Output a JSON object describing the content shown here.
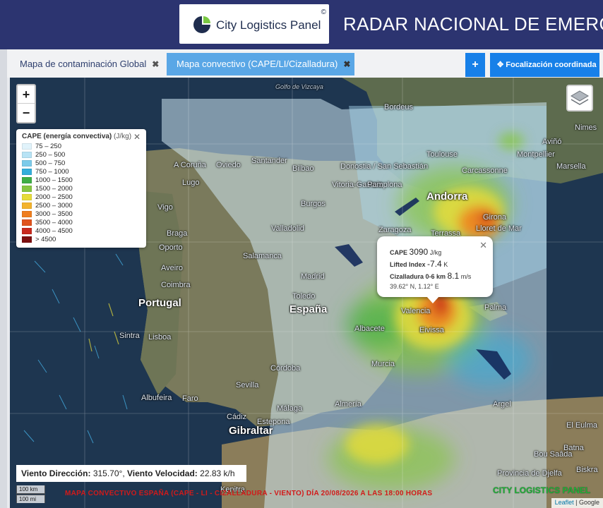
{
  "header": {
    "logo_text": "City Logistics Panel",
    "logo_copyright": "©",
    "title": "RADAR NACIONAL DE EMERGE"
  },
  "tabs": [
    {
      "label": "Mapa de contaminación Global",
      "close": "✖",
      "active": false
    },
    {
      "label": "Mapa convectivo (CAPE/LI/Cizalladura)",
      "close": "✖",
      "active": true
    }
  ],
  "toolbar": {
    "plus_label": "+",
    "focus_icon": "crosshair-icon",
    "focus_label": "Focalización coordinada"
  },
  "map": {
    "zoom_in": "+",
    "zoom_out": "−",
    "places": [
      {
        "name": "Golfo de Vizcaya",
        "cls": "sea"
      },
      {
        "name": "Bordeus",
        "cls": ""
      },
      {
        "name": "Toulouse",
        "cls": ""
      },
      {
        "name": "Montpellier",
        "cls": ""
      },
      {
        "name": "Marsella",
        "cls": ""
      },
      {
        "name": "Aviñó",
        "cls": ""
      },
      {
        "name": "Nimes",
        "cls": ""
      },
      {
        "name": "Carcassonne",
        "cls": ""
      },
      {
        "name": "A Coruña",
        "cls": ""
      },
      {
        "name": "Oviedo",
        "cls": ""
      },
      {
        "name": "Santander",
        "cls": ""
      },
      {
        "name": "Bilbao",
        "cls": ""
      },
      {
        "name": "Donostia / San Sebastián",
        "cls": ""
      },
      {
        "name": "Vitoria-Gasteiz",
        "cls": ""
      },
      {
        "name": "Pamplona",
        "cls": ""
      },
      {
        "name": "Andorra",
        "cls": "big"
      },
      {
        "name": "Lugo",
        "cls": ""
      },
      {
        "name": "Vigo",
        "cls": ""
      },
      {
        "name": "Burgos",
        "cls": ""
      },
      {
        "name": "Braga",
        "cls": ""
      },
      {
        "name": "Oporto",
        "cls": ""
      },
      {
        "name": "Valladolid",
        "cls": ""
      },
      {
        "name": "Zaragoza",
        "cls": ""
      },
      {
        "name": "Girona",
        "cls": ""
      },
      {
        "name": "Lloret de Mar",
        "cls": ""
      },
      {
        "name": "Terrassa",
        "cls": ""
      },
      {
        "name": "Aveiro",
        "cls": ""
      },
      {
        "name": "Salamanca",
        "cls": ""
      },
      {
        "name": "Coimbra",
        "cls": ""
      },
      {
        "name": "Madrid",
        "cls": ""
      },
      {
        "name": "Portugal",
        "cls": "big"
      },
      {
        "name": "Toledo",
        "cls": ""
      },
      {
        "name": "España",
        "cls": "big"
      },
      {
        "name": "Valencia",
        "cls": ""
      },
      {
        "name": "Palma",
        "cls": ""
      },
      {
        "name": "Lisboa",
        "cls": ""
      },
      {
        "name": "Sintra",
        "cls": ""
      },
      {
        "name": "Albacete",
        "cls": ""
      },
      {
        "name": "Eivissa",
        "cls": ""
      },
      {
        "name": "Murcia",
        "cls": ""
      },
      {
        "name": "Córdoba",
        "cls": ""
      },
      {
        "name": "Sevilla",
        "cls": ""
      },
      {
        "name": "Albufeira",
        "cls": ""
      },
      {
        "name": "Faro",
        "cls": ""
      },
      {
        "name": "Málaga",
        "cls": ""
      },
      {
        "name": "Almería",
        "cls": ""
      },
      {
        "name": "Cádiz",
        "cls": ""
      },
      {
        "name": "Estepona",
        "cls": ""
      },
      {
        "name": "Gibraltar",
        "cls": "big"
      },
      {
        "name": "Argel",
        "cls": ""
      },
      {
        "name": "El Eulma",
        "cls": ""
      },
      {
        "name": "Bou Saâda",
        "cls": ""
      },
      {
        "name": "Batna",
        "cls": ""
      },
      {
        "name": "Provincia de Djelfa",
        "cls": ""
      },
      {
        "name": "Biskra",
        "cls": ""
      },
      {
        "name": "Kenitra",
        "cls": ""
      }
    ]
  },
  "legend": {
    "title": "CAPE (energía convectiva)",
    "unit": "(J/kg)",
    "close": "✕",
    "items": [
      {
        "label": "75 – 250",
        "color": "#e1f3fb"
      },
      {
        "label": "250 – 500",
        "color": "#b8e3f5"
      },
      {
        "label": "500 – 750",
        "color": "#7ccbea"
      },
      {
        "label": "750 – 1000",
        "color": "#34aedb"
      },
      {
        "label": "1000 – 1500",
        "color": "#3fae46"
      },
      {
        "label": "1500 – 2000",
        "color": "#86c642"
      },
      {
        "label": "2000 – 2500",
        "color": "#e6dc3a"
      },
      {
        "label": "2500 – 3000",
        "color": "#f3b32c"
      },
      {
        "label": "3000 – 3500",
        "color": "#ef7e1e"
      },
      {
        "label": "3500 – 4000",
        "color": "#e0531c"
      },
      {
        "label": "4000 – 4500",
        "color": "#c82a1e"
      },
      {
        "label": "> 4500",
        "color": "#7d1010"
      }
    ]
  },
  "popup": {
    "close": "✕",
    "cape_label": "CAPE",
    "cape_value": "3090",
    "cape_unit": "J/kg",
    "li_label": "Lifted Index",
    "li_value": "-7.4",
    "li_unit": "K",
    "shear_label": "Cizalladura 0-6 km",
    "shear_value": "8.1",
    "shear_unit": "m/s",
    "coords": "39.62° N, 1.12° E"
  },
  "wind": {
    "dir_label": "Viento Dirección:",
    "dir_value": "315.70°,",
    "speed_label": "Viento Velocidad:",
    "speed_value": "22.83 k/h"
  },
  "scale": {
    "km": "100 km",
    "mi": "100 mi"
  },
  "caption": "MAPA CONVECTIVO ESPAÑA (CAPE - LI - CIZALLADURA - VIENTO) DÍA 20/08/2026 A LAS 18:00 HORAS",
  "watermark": "CITY LOGISTICS PANEL",
  "attribution": {
    "leaflet": "Leaflet",
    "sep": " | ",
    "google": "Google"
  }
}
